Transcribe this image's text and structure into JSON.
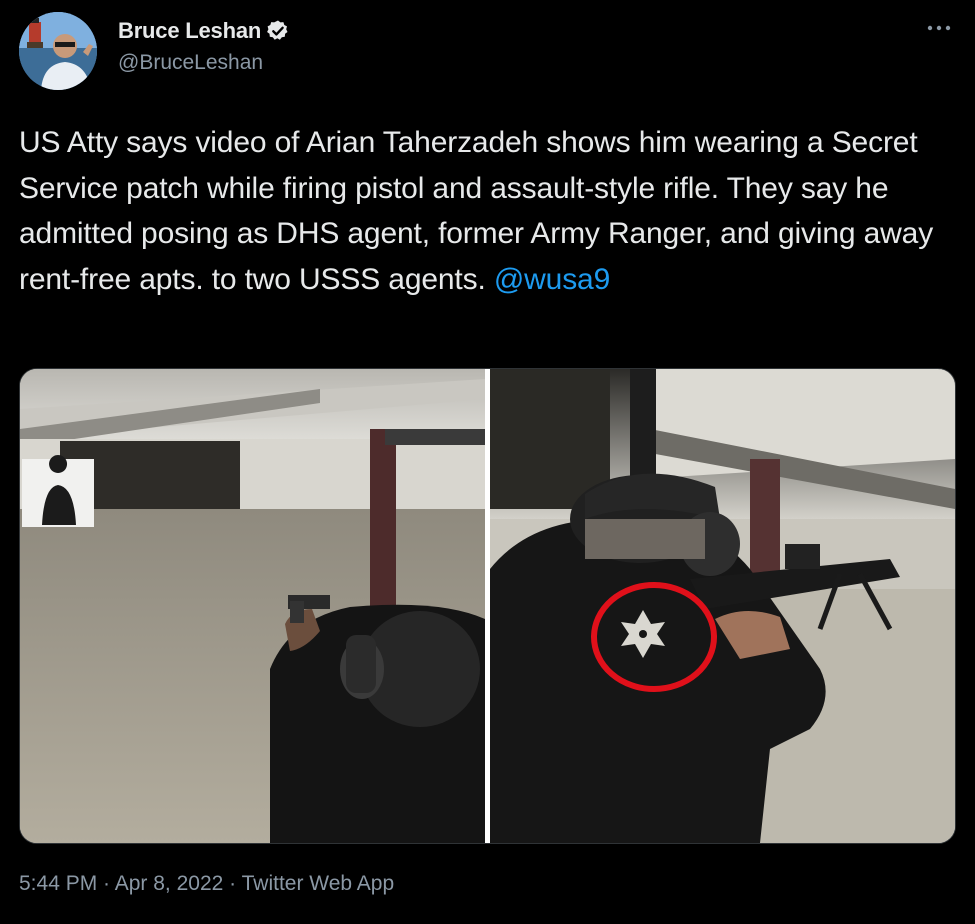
{
  "author": {
    "name": "Bruce Leshan",
    "handle": "@BruceLeshan",
    "verified": true,
    "avatar_icon": "profile-photo"
  },
  "tweet": {
    "text_before_mention": "US Atty says video of Arian Taherzadeh shows him wearing a Secret Service patch while firing pistol and assault-style rifle. They say he admitted posing as DHS agent, former Army Ranger, and giving away rent-free apts. to two USSS agents. ",
    "mention": "@wusa9",
    "media_count": 2
  },
  "meta": {
    "time": "5:44 PM",
    "separator": " · ",
    "date": "Apr 8, 2022",
    "source": "Twitter Web App"
  },
  "colors": {
    "background": "#000000",
    "text": "#e7e9ea",
    "secondary_text": "#8b98a5",
    "link": "#1d9bf0",
    "highlight_circle": "#e0101a"
  },
  "icons": {
    "more": "more-horizontal-icon",
    "verified": "verified-badge-icon"
  }
}
